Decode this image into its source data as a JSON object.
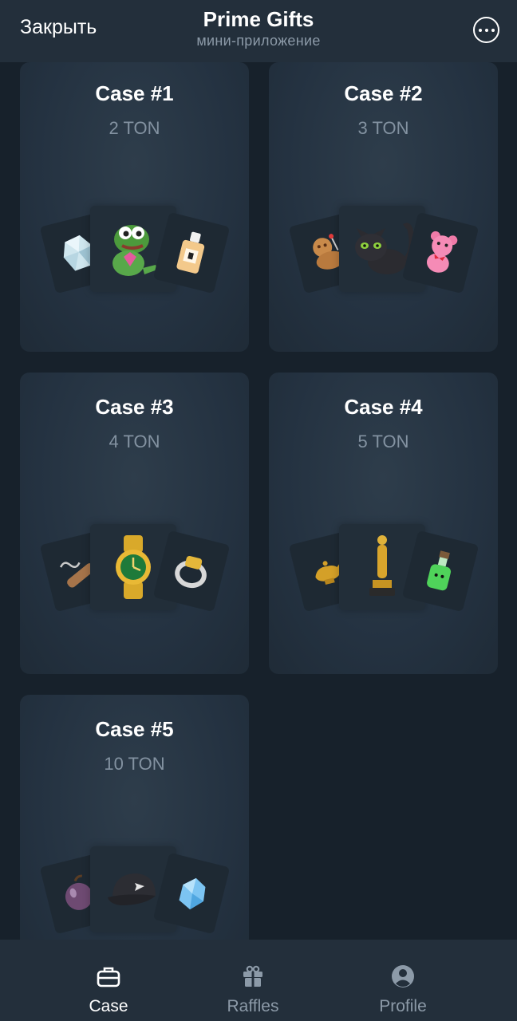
{
  "header": {
    "close_label": "Закрыть",
    "title": "Prime Gifts",
    "subtitle": "мини-приложение"
  },
  "cases": [
    {
      "title": "Case #1",
      "price": "2 TON",
      "items": [
        "diamond-icon",
        "pepe-frog-icon",
        "perfume-bottle-icon"
      ]
    },
    {
      "title": "Case #2",
      "price": "3 TON",
      "items": [
        "voodoo-doll-icon",
        "black-cat-icon",
        "pink-teddy-bear-icon"
      ]
    },
    {
      "title": "Case #3",
      "price": "4 TON",
      "items": [
        "cigar-icon",
        "gold-watch-icon",
        "signet-ring-icon"
      ]
    },
    {
      "title": "Case #4",
      "price": "5 TON",
      "items": [
        "magic-lamp-icon",
        "oscar-statuette-icon",
        "green-potion-icon"
      ]
    },
    {
      "title": "Case #5",
      "price": "10 TON",
      "items": [
        "plum-icon",
        "black-cap-icon",
        "ice-crystal-icon"
      ]
    }
  ],
  "tabs": [
    {
      "label": "Case",
      "icon": "briefcase-icon",
      "active": true
    },
    {
      "label": "Raffles",
      "icon": "gift-icon",
      "active": false
    },
    {
      "label": "Profile",
      "icon": "user-icon",
      "active": false
    }
  ],
  "colors": {
    "background": "#17212b",
    "bar": "#232f3b",
    "card": "#27343f",
    "muted_text": "#8392a1",
    "active_tab": "#ffffff",
    "inactive_tab": "#8c9aa8"
  }
}
